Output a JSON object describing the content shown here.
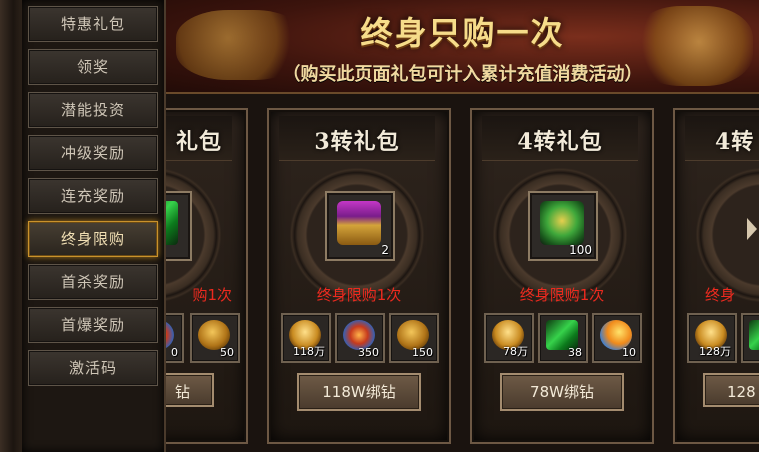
{
  "sidebar": {
    "items": [
      {
        "label": "特惠礼包",
        "active": false
      },
      {
        "label": "领奖",
        "active": false
      },
      {
        "label": "潜能投资",
        "active": false
      },
      {
        "label": "冲级奖励",
        "active": false
      },
      {
        "label": "连充奖励",
        "active": false
      },
      {
        "label": "终身限购",
        "active": true
      },
      {
        "label": "首杀奖励",
        "active": false
      },
      {
        "label": "首爆奖励",
        "active": false
      },
      {
        "label": "激活码",
        "active": false
      }
    ]
  },
  "banner": {
    "title": "终身只购一次",
    "subtitle": "（购买此页面礼包可计入累计充值消费活动）"
  },
  "cards": [
    {
      "title": "礼包",
      "main_item": {
        "icon": "green-item-icon",
        "qty": ""
      },
      "limit_text": "购1次",
      "items": [
        {
          "icon": "ingot-icon",
          "qty": ""
        },
        {
          "icon": "gem-icon",
          "qty": "0"
        },
        {
          "icon": "coin-icon",
          "qty": "50"
        }
      ],
      "buy_label": "钻"
    },
    {
      "title": "3转礼包",
      "main_item": {
        "icon": "treasure-chest-icon",
        "qty": "2"
      },
      "limit_text": "终身限购1次",
      "items": [
        {
          "icon": "gold-ingot-icon",
          "qty": "118万"
        },
        {
          "icon": "gem-icon",
          "qty": "350"
        },
        {
          "icon": "coin-icon",
          "qty": "150"
        }
      ],
      "buy_label": "118W绑钻"
    },
    {
      "title": "4转礼包",
      "main_item": {
        "icon": "jade-hand-icon",
        "qty": "100"
      },
      "limit_text": "终身限购1次",
      "items": [
        {
          "icon": "gold-ingot-icon",
          "qty": "78万"
        },
        {
          "icon": "green-crystal-icon",
          "qty": "38"
        },
        {
          "icon": "feather-icon",
          "qty": "10"
        }
      ],
      "buy_label": "78W绑钻"
    },
    {
      "title": "4转",
      "main_item": {
        "icon": "item-icon",
        "qty": ""
      },
      "limit_text": "终身",
      "items": [
        {
          "icon": "gold-ingot-icon",
          "qty": "128万"
        },
        {
          "icon": "item-icon",
          "qty": ""
        }
      ],
      "buy_label": "128"
    }
  ]
}
